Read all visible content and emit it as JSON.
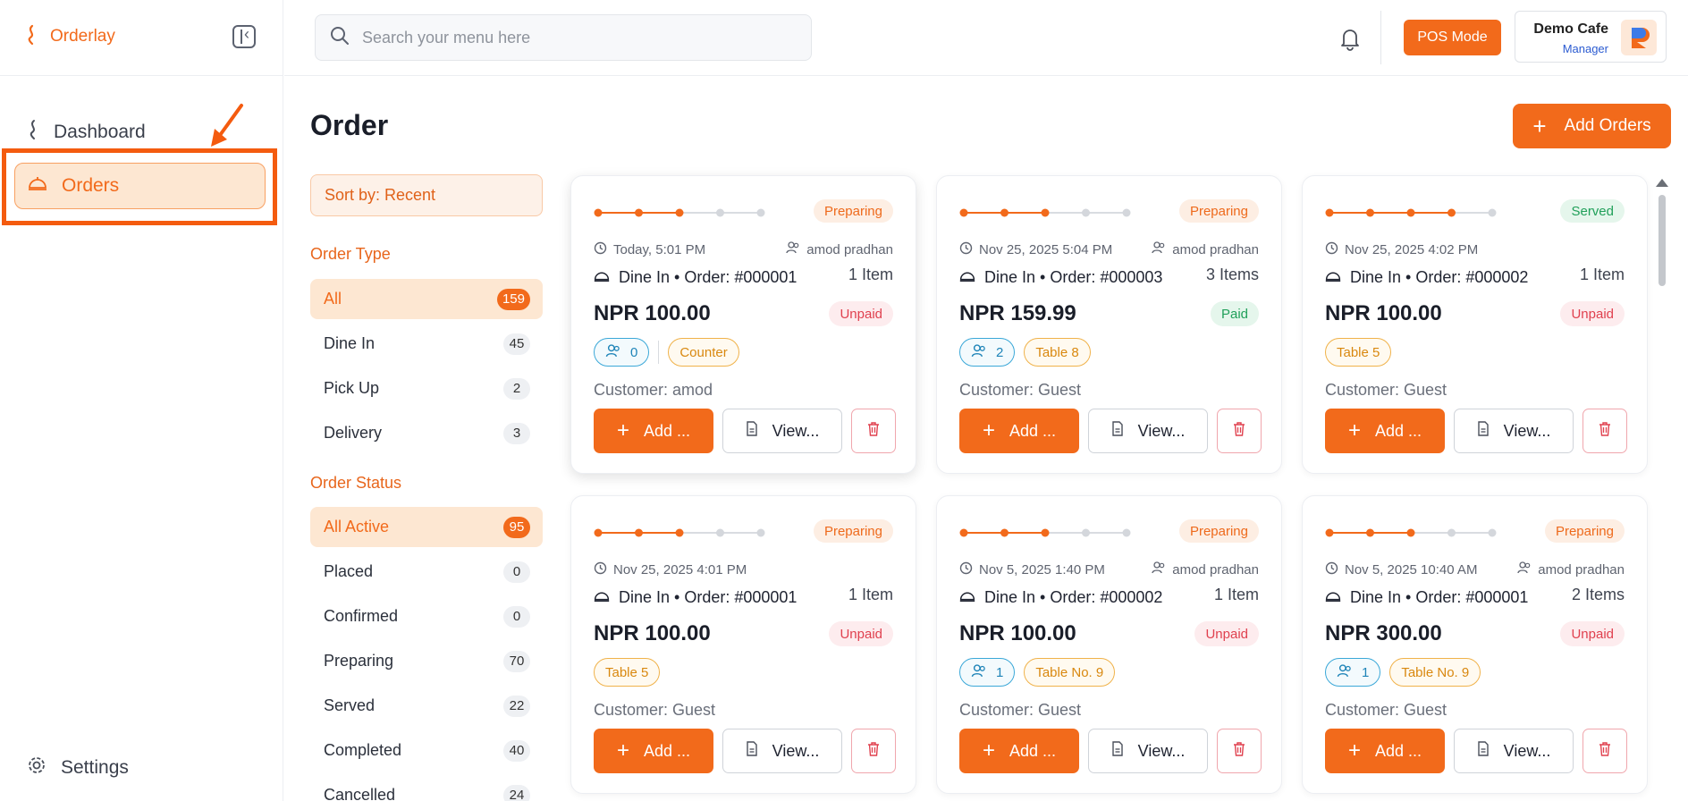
{
  "colors": {
    "accent": "#f26a1b",
    "paid": "#21a05a",
    "unpaid": "#e0414f"
  },
  "sidebar": {
    "brand": "Orderlay",
    "items": [
      {
        "label": "Dashboard",
        "icon": "dashboard-icon"
      },
      {
        "label": "Orders",
        "icon": "cloche-icon",
        "active": true
      },
      {
        "label": "Settings",
        "icon": "gear-icon"
      }
    ]
  },
  "topbar": {
    "search_placeholder": "Search your menu here",
    "pos_mode": "POS Mode",
    "profile_name": "Demo Cafe",
    "profile_role": "Manager"
  },
  "main": {
    "title": "Order",
    "add_orders": "Add Orders",
    "sort_label": "Sort by: Recent"
  },
  "filters": {
    "order_type_label": "Order Type",
    "order_type": [
      {
        "label": "All",
        "count": "159",
        "active": true
      },
      {
        "label": "Dine In",
        "count": "45"
      },
      {
        "label": "Pick Up",
        "count": "2"
      },
      {
        "label": "Delivery",
        "count": "3"
      }
    ],
    "order_status_label": "Order Status",
    "order_status": [
      {
        "label": "All Active",
        "count": "95",
        "active": true
      },
      {
        "label": "Placed",
        "count": "0"
      },
      {
        "label": "Confirmed",
        "count": "0"
      },
      {
        "label": "Preparing",
        "count": "70"
      },
      {
        "label": "Served",
        "count": "22"
      },
      {
        "label": "Completed",
        "count": "40"
      },
      {
        "label": "Cancelled",
        "count": "24"
      }
    ]
  },
  "orders": [
    {
      "status": "Preparing",
      "progress_steps": 3,
      "time": "Today, 5:01 PM",
      "user": "amod pradhan",
      "order": "Dine In • Order: #000001",
      "items": "1 Item",
      "price": "NPR 100.00",
      "payment": "Unpaid",
      "guests": "0",
      "table": "Counter",
      "customer": "Customer: amod",
      "add": "Add ...",
      "view": "View..."
    },
    {
      "status": "Preparing",
      "progress_steps": 3,
      "time": "Nov 25, 2025 5:04 PM",
      "user": "amod pradhan",
      "order": "Dine In • Order: #000003",
      "items": "3 Items",
      "price": "NPR 159.99",
      "payment": "Paid",
      "guests": "2",
      "table": "Table 8",
      "customer": "Customer: Guest",
      "add": "Add ...",
      "view": "View..."
    },
    {
      "status": "Served",
      "progress_steps": 4,
      "time": "Nov 25, 2025 4:02 PM",
      "user": "",
      "order": "Dine In • Order: #000002",
      "items": "1 Item",
      "price": "NPR 100.00",
      "payment": "Unpaid",
      "guests": "",
      "table": "Table 5",
      "customer": "Customer: Guest",
      "add": "Add ...",
      "view": "View..."
    },
    {
      "status": "Preparing",
      "progress_steps": 3,
      "time": "Nov 25, 2025 4:01 PM",
      "user": "",
      "order": "Dine In • Order: #000001",
      "items": "1 Item",
      "price": "NPR 100.00",
      "payment": "Unpaid",
      "guests": "",
      "table": "Table 5",
      "customer": "Customer: Guest",
      "add": "Add ...",
      "view": "View..."
    },
    {
      "status": "Preparing",
      "progress_steps": 3,
      "time": "Nov 5, 2025 1:40 PM",
      "user": "amod pradhan",
      "order": "Dine In • Order: #000002",
      "items": "1 Item",
      "price": "NPR 100.00",
      "payment": "Unpaid",
      "guests": "1",
      "table": "Table No. 9",
      "customer": "Customer: Guest",
      "add": "Add ...",
      "view": "View..."
    },
    {
      "status": "Preparing",
      "progress_steps": 3,
      "time": "Nov 5, 2025 10:40 AM",
      "user": "amod pradhan",
      "order": "Dine In • Order: #000001",
      "items": "2 Items",
      "price": "NPR 300.00",
      "payment": "Unpaid",
      "guests": "1",
      "table": "Table No. 9",
      "customer": "Customer: Guest",
      "add": "Add ...",
      "view": "View..."
    }
  ]
}
